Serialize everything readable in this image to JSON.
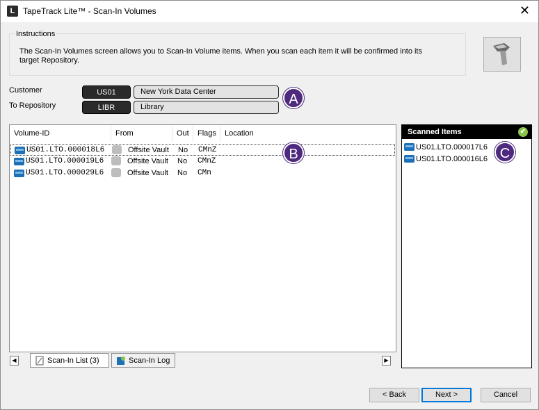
{
  "window": {
    "title": "TapeTrack Lite™ - Scan-In Volumes",
    "app_icon": "L",
    "close_glyph": "✕"
  },
  "instructions": {
    "legend": "Instructions",
    "text": "The Scan-In Volumes screen allows you to Scan-In Volume items. When you scan each item it will be confirmed into its target Repository."
  },
  "customer": {
    "label": "Customer",
    "code": "US01",
    "name": "New York Data Center"
  },
  "repository": {
    "label": "To Repository",
    "code": "LIBR",
    "name": "Library"
  },
  "badges": {
    "a": "A",
    "b": "B",
    "c": "C"
  },
  "list": {
    "columns": [
      "Volume-ID",
      "From",
      "Out",
      "Flags",
      "Location"
    ],
    "rows": [
      {
        "volume_id": "US01.LTO.000018L6",
        "from": "Offsite Vault",
        "out": "No",
        "flags": "CMnZ",
        "location": ""
      },
      {
        "volume_id": "US01.LTO.000019L6",
        "from": "Offsite Vault",
        "out": "No",
        "flags": "CMnZ",
        "location": ""
      },
      {
        "volume_id": "US01.LTO.000029L6",
        "from": "Offsite Vault",
        "out": "No",
        "flags": "CMn",
        "location": ""
      }
    ]
  },
  "tabs": [
    {
      "label": "Scan-In List (3)",
      "icon": "document-icon",
      "active": true
    },
    {
      "label": "Scan-In Log",
      "icon": "log-icon",
      "active": false
    }
  ],
  "scanned": {
    "header": "Scanned Items",
    "items": [
      "US01.LTO.000017L6",
      "US01.LTO.000016L6"
    ]
  },
  "buttons": {
    "back": "< Back",
    "next": "Next >",
    "cancel": "Cancel"
  },
  "colors": {
    "badge": "#4e2a7e",
    "tape": "#1e6fb5",
    "accent": "#0078d7",
    "check": "#8bc34a"
  }
}
